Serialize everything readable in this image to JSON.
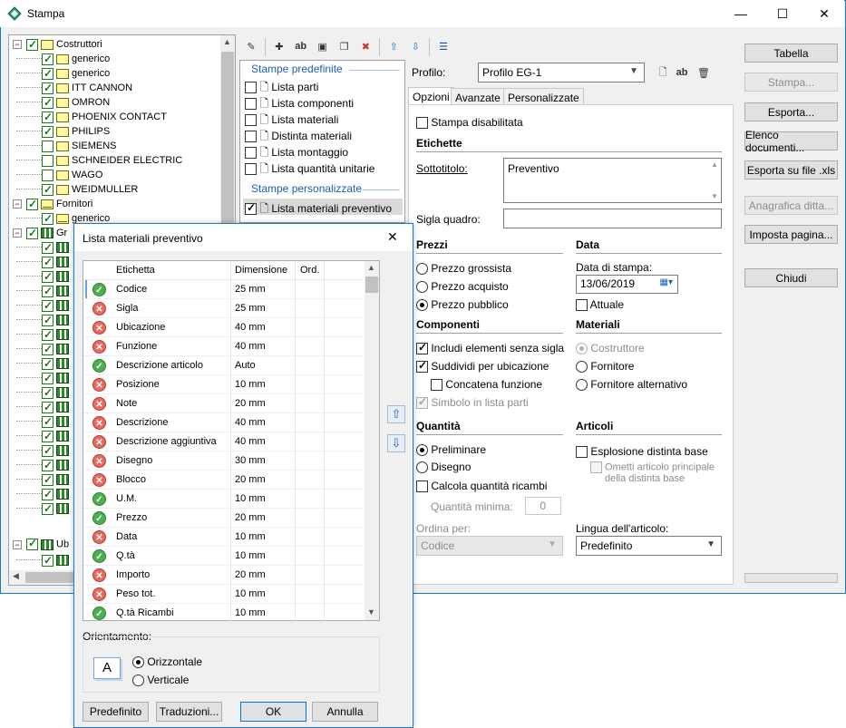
{
  "window": {
    "title": "Stampa",
    "min": "—",
    "max": "☐",
    "close": "✕"
  },
  "tree": {
    "items": [
      {
        "label": "Costruttori",
        "indent": 0,
        "checked": true,
        "expand": "−",
        "icon": "folder"
      },
      {
        "label": "generico",
        "indent": 1,
        "checked": true,
        "icon": "folder"
      },
      {
        "label": "generico",
        "indent": 1,
        "checked": true,
        "icon": "folder"
      },
      {
        "label": "ITT CANNON",
        "indent": 1,
        "checked": true,
        "icon": "folder"
      },
      {
        "label": "OMRON",
        "indent": 1,
        "checked": true,
        "icon": "folder"
      },
      {
        "label": "PHOENIX CONTACT",
        "indent": 1,
        "checked": true,
        "icon": "folder"
      },
      {
        "label": "PHILIPS",
        "indent": 1,
        "checked": true,
        "icon": "folder"
      },
      {
        "label": "SIEMENS",
        "indent": 1,
        "checked": false,
        "icon": "folder"
      },
      {
        "label": "SCHNEIDER ELECTRIC",
        "indent": 1,
        "checked": false,
        "icon": "folder"
      },
      {
        "label": "WAGO",
        "indent": 1,
        "checked": false,
        "icon": "folder"
      },
      {
        "label": "WEIDMULLER",
        "indent": 1,
        "checked": true,
        "icon": "folder"
      },
      {
        "label": "Fornitori",
        "indent": 0,
        "checked": true,
        "expand": "−",
        "icon": "envelope"
      },
      {
        "label": "generico",
        "indent": 1,
        "checked": true,
        "icon": "envelope"
      },
      {
        "label": "Gr",
        "indent": 0,
        "checked": true,
        "expand": "−",
        "icon": "grid"
      }
    ],
    "ub_label": "Ub"
  },
  "print_list": {
    "predefined_header": "Stampe predefinite",
    "predefined": [
      "Lista parti",
      "Lista componenti",
      "Lista materiali",
      "Distinta materiali",
      "Lista montaggio",
      "Lista quantità unitarie"
    ],
    "custom_header": "Stampe personalizzate",
    "custom": [
      "Lista materiali preventivo"
    ]
  },
  "profile": {
    "label": "Profilo:",
    "value": "Profilo EG-1"
  },
  "tabs": [
    "Opzioni",
    "Avanzate",
    "Personalizzate"
  ],
  "options": {
    "disabled_print": "Stampa disabilitata",
    "labels_section": "Etichette",
    "subtitle_label": "Sottotitolo:",
    "subtitle_value": "Preventivo",
    "sigla_label": "Sigla quadro:",
    "prices_section": "Prezzi",
    "price_wholesale": "Prezzo grossista",
    "price_purchase": "Prezzo acquisto",
    "price_public": "Prezzo pubblico",
    "date_section": "Data",
    "print_date_label": "Data di stampa:",
    "print_date_value": "13/06/2019",
    "current": "Attuale",
    "components_section": "Componenti",
    "include_no_label": "Includi elementi senza sigla",
    "split_by_location": "Suddividi per ubicazione",
    "concat_function": "Concatena funzione",
    "symbol_in_list": "Simbolo in lista parti",
    "materials_section": "Materiali",
    "manufacturer": "Costruttore",
    "supplier": "Fornitore",
    "alt_supplier": "Fornitore alternativo",
    "quantity_section": "Quantità",
    "preliminary": "Preliminare",
    "drawing": "Disegno",
    "calc_spares": "Calcola quantità ricambi",
    "min_qty_label": "Quantità minima:",
    "min_qty_value": "0",
    "articles_section": "Articoli",
    "bom_explosion": "Esplosione distinta base",
    "omit_main_1": "Ometti articolo principale",
    "omit_main_2": "della distinta base",
    "order_by_label": "Ordina per:",
    "order_by_value": "Codice",
    "lang_label": "Lingua dell'articolo:",
    "lang_value": "Predefinito"
  },
  "right_buttons": {
    "tabella": "Tabella",
    "stampa": "Stampa...",
    "esporta": "Esporta...",
    "elenco": "Elenco documenti...",
    "xls": "Esporta su file .xls",
    "anagrafica": "Anagrafica ditta...",
    "imposta": "Imposta pagina...",
    "chiudi": "Chiudi"
  },
  "dialog": {
    "title": "Lista materiali preventivo",
    "close": "✕",
    "headers": [
      "Etichetta",
      "Dimensione",
      "Ord."
    ],
    "rows": [
      {
        "ok": true,
        "label": "Codice",
        "size": "25 mm"
      },
      {
        "ok": false,
        "label": "Sigla",
        "size": "25 mm"
      },
      {
        "ok": false,
        "label": "Ubicazione",
        "size": "40 mm"
      },
      {
        "ok": false,
        "label": "Funzione",
        "size": "40 mm"
      },
      {
        "ok": true,
        "label": "Descrizione articolo",
        "size": "Auto"
      },
      {
        "ok": false,
        "label": "Posizione",
        "size": "10 mm"
      },
      {
        "ok": false,
        "label": "Note",
        "size": "20 mm"
      },
      {
        "ok": false,
        "label": "Descrizione",
        "size": "40 mm"
      },
      {
        "ok": false,
        "label": "Descrizione aggiuntiva",
        "size": "40 mm"
      },
      {
        "ok": false,
        "label": "Disegno",
        "size": "30 mm"
      },
      {
        "ok": false,
        "label": "Blocco",
        "size": "20 mm"
      },
      {
        "ok": true,
        "label": "U.M.",
        "size": "10 mm"
      },
      {
        "ok": true,
        "label": "Prezzo",
        "size": "20 mm"
      },
      {
        "ok": false,
        "label": "Data",
        "size": "10 mm"
      },
      {
        "ok": true,
        "label": "Q.tà",
        "size": "10 mm"
      },
      {
        "ok": false,
        "label": "Importo",
        "size": "20 mm"
      },
      {
        "ok": false,
        "label": "Peso tot.",
        "size": "10 mm"
      },
      {
        "ok": true,
        "label": "Q.tà Ricambi",
        "size": "10 mm"
      }
    ],
    "orientation_label": "Orientamento:",
    "horizontal": "Orizzontale",
    "vertical": "Verticale",
    "orientation_icon_letter": "A",
    "btn_default": "Predefinito",
    "btn_translations": "Traduzioni...",
    "btn_ok": "OK",
    "btn_cancel": "Annulla"
  }
}
